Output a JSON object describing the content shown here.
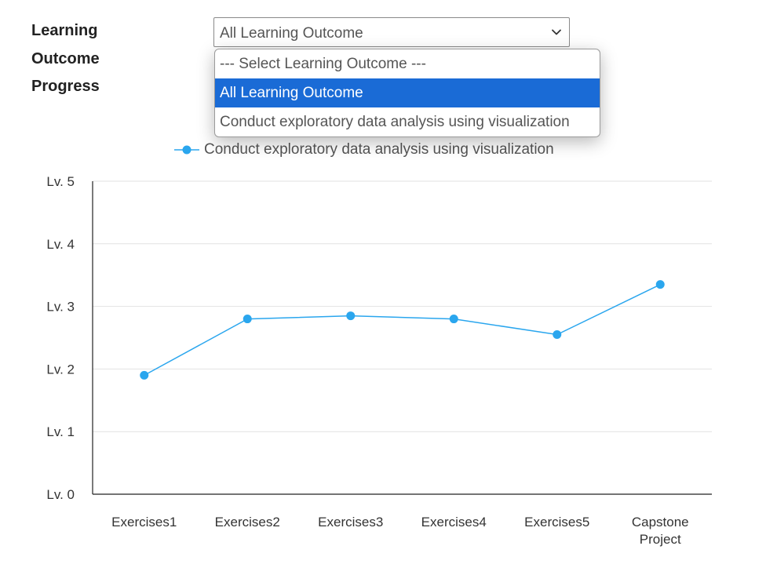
{
  "header": {
    "title": "Learning Outcome Progress"
  },
  "select": {
    "value": "All Learning Outcome",
    "options": [
      "--- Select Learning Outcome ---",
      "All Learning Outcome",
      "Conduct exploratory data analysis using visualization"
    ],
    "selected_index": 1
  },
  "colors": {
    "series": "#2aa6ee",
    "selected_option": "#1a6bd6",
    "gridline": "#e2e2e2",
    "axis": "#222222"
  },
  "chart_data": {
    "type": "line",
    "categories": [
      "Exercises1",
      "Exercises2",
      "Exercises3",
      "Exercises4",
      "Exercises5",
      "Capstone Project"
    ],
    "series": [
      {
        "name": "Conduct exploratory data analysis using visualization",
        "values": [
          1.9,
          2.8,
          2.85,
          2.8,
          2.55,
          3.35
        ]
      }
    ],
    "yticks": [
      "Lv. 0",
      "Lv. 1",
      "Lv. 2",
      "Lv. 3",
      "Lv. 4",
      "Lv. 5"
    ],
    "ylim": [
      0,
      5
    ],
    "grid": true,
    "legend": "top"
  }
}
